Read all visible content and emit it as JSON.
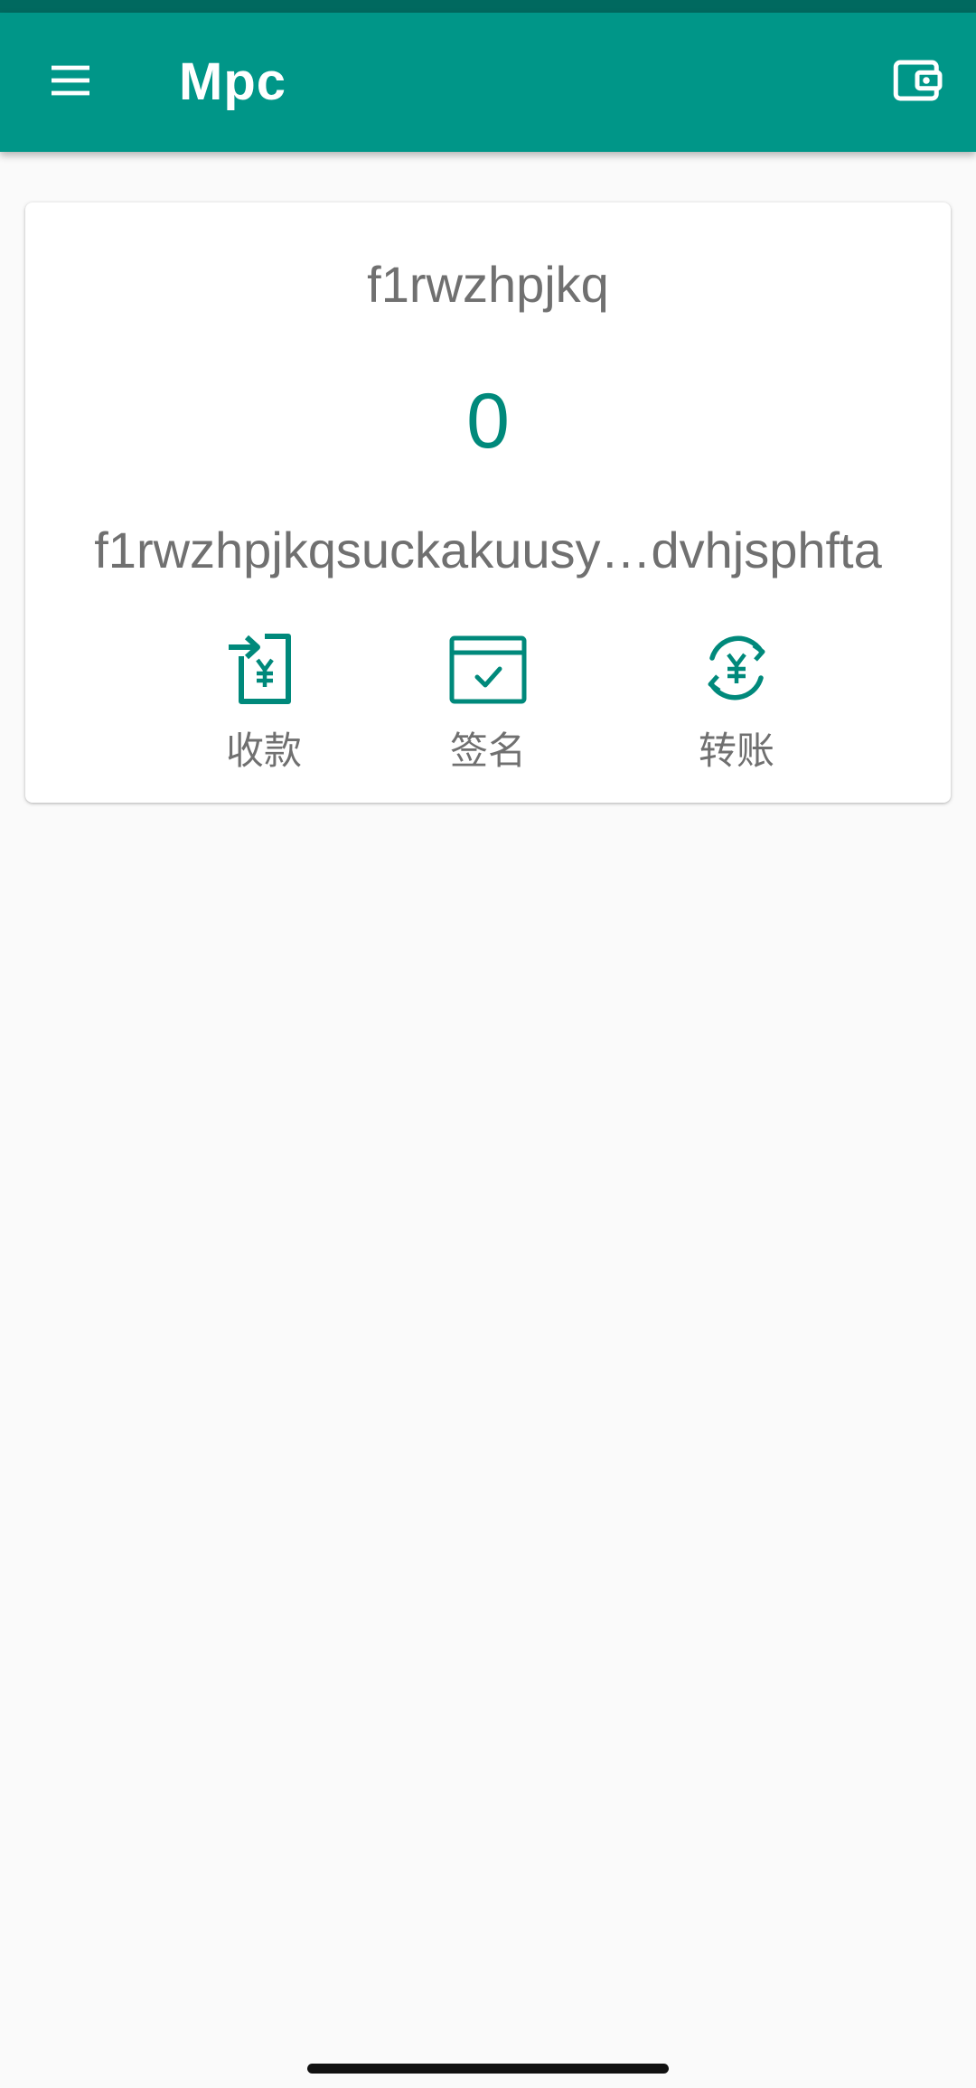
{
  "app_bar": {
    "title": "Mpc",
    "menu_icon": "menu-icon",
    "wallet_icon": "wallet-icon",
    "bg_color": "#009688",
    "status_bar_color": "#00695f"
  },
  "card": {
    "wallet_name": "f1rwzhpjkq",
    "balance": "0",
    "address": "f1rwzhpjkqsuckakuusy…dvhjsphfta"
  },
  "actions": [
    {
      "label": "收款",
      "icon": "receive-icon"
    },
    {
      "label": "签名",
      "icon": "sign-icon"
    },
    {
      "label": "转账",
      "icon": "transfer-icon"
    }
  ],
  "colors": {
    "accent": "#00897b",
    "text_secondary": "#707070"
  }
}
